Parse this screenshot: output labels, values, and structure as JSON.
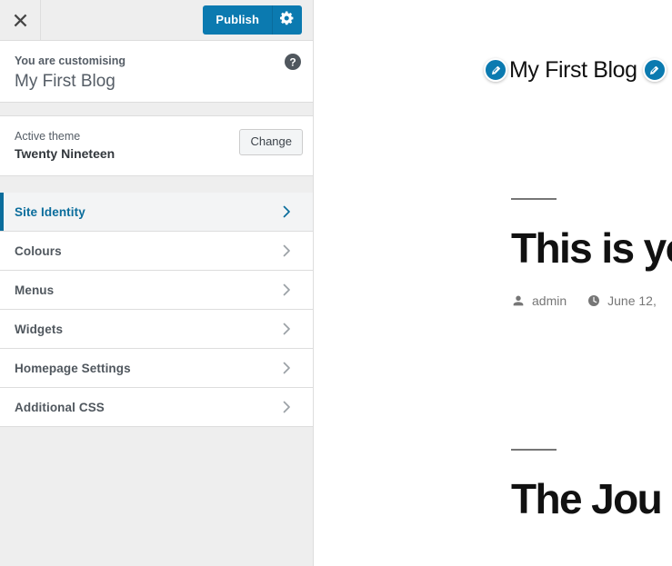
{
  "sidebar": {
    "header": {
      "close_icon": "close-x-icon",
      "publish_label": "Publish",
      "gear_icon": "gear-icon"
    },
    "customising": {
      "label": "You are customising",
      "site_title": "My First Blog",
      "help_icon": "help-question-icon"
    },
    "theme": {
      "label": "Active theme",
      "name": "Twenty Nineteen",
      "change_label": "Change"
    },
    "nav_items": [
      {
        "label": "Site Identity",
        "active": true,
        "chevron_icon": "chevron-right-icon"
      },
      {
        "label": "Colours",
        "active": false,
        "chevron_icon": "chevron-right-icon"
      },
      {
        "label": "Menus",
        "active": false,
        "chevron_icon": "chevron-right-icon"
      },
      {
        "label": "Widgets",
        "active": false,
        "chevron_icon": "chevron-right-icon"
      },
      {
        "label": "Homepage Settings",
        "active": false,
        "chevron_icon": "chevron-right-icon"
      },
      {
        "label": "Additional CSS",
        "active": false,
        "chevron_icon": "chevron-right-icon"
      }
    ]
  },
  "preview": {
    "site_title": "My First Blog",
    "edit_icon_left": "edit-pencil-icon",
    "edit_icon_right": "edit-pencil-icon",
    "posts": [
      {
        "title": "This is yo",
        "author_icon": "person-icon",
        "author": "admin",
        "date_icon": "clock-icon",
        "date": "June 12,"
      },
      {
        "title": "The Jou"
      }
    ]
  },
  "colors": {
    "wp_blue": "#0b7ab0",
    "accent_blue": "#0b6d9c",
    "sidebar_bg": "#eeeeee",
    "panel_bg": "#ffffff",
    "border": "#dddddd",
    "text_gray": "#50575e",
    "meta_gray": "#767676"
  }
}
